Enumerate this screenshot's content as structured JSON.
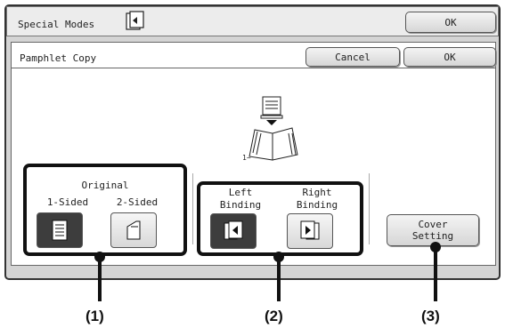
{
  "header": {
    "title": "Special Modes",
    "ok_label": "OK"
  },
  "subheader": {
    "title": "Pamphlet Copy",
    "cancel_label": "Cancel",
    "ok_label": "OK"
  },
  "original": {
    "title": "Original",
    "option1": "1-Sided",
    "option2": "2-Sided",
    "selected": "1-Sided"
  },
  "binding": {
    "left_line1": "Left",
    "left_line2": "Binding",
    "right_line1": "Right",
    "right_line2": "Binding",
    "selected": "Left Binding"
  },
  "cover": {
    "line1": "Cover",
    "line2": "Setting"
  },
  "illustration": {
    "page_label": "1~"
  },
  "callouts": [
    "(1)",
    "(2)",
    "(3)"
  ],
  "colors": {
    "selected": "#3d3d3d",
    "frame": "#d4d4d4",
    "group_border": "#111111"
  }
}
